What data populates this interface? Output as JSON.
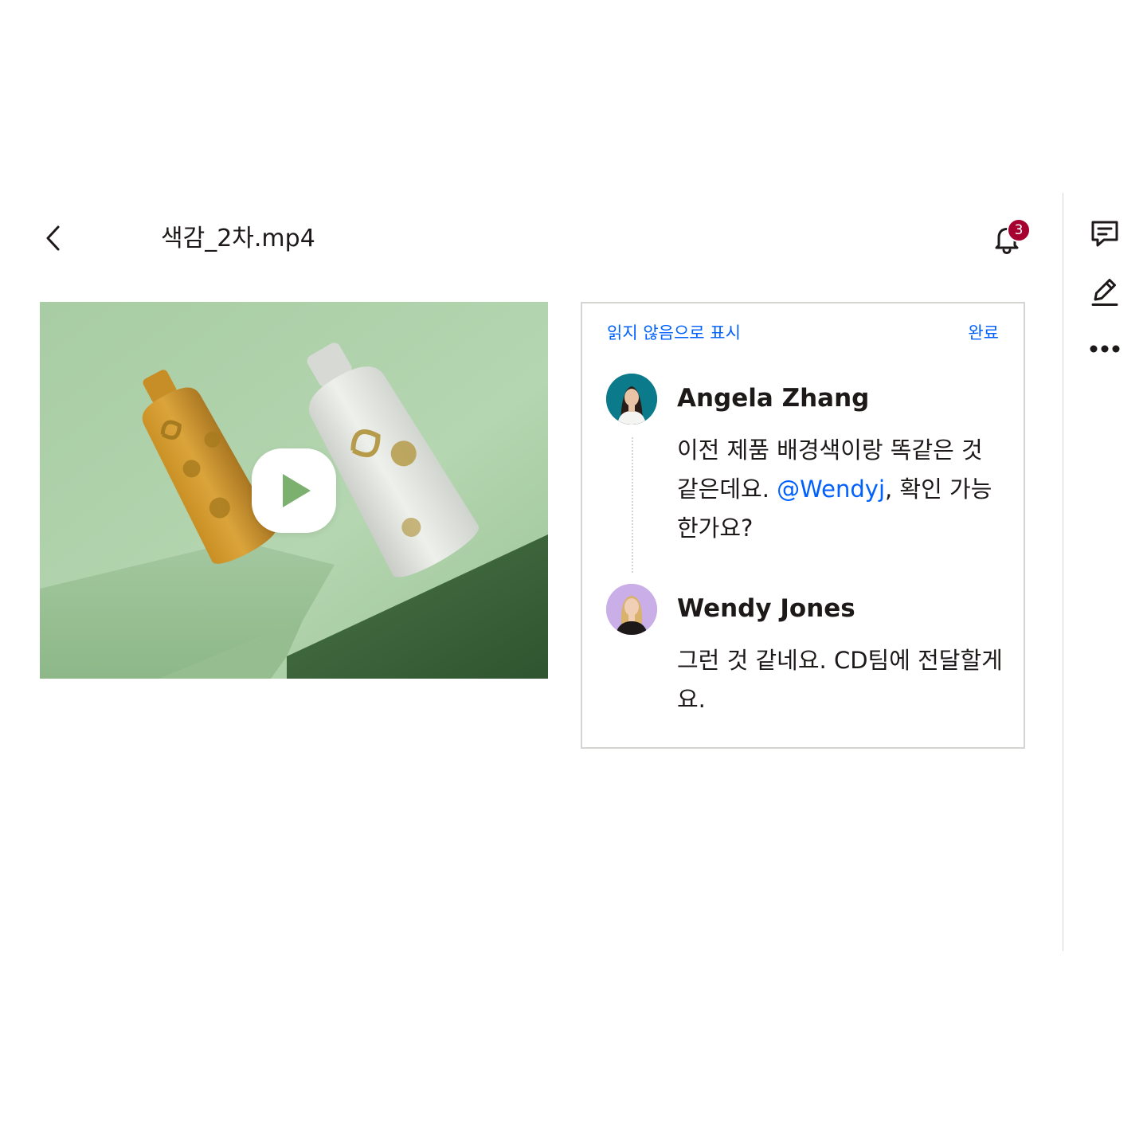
{
  "header": {
    "file_name": "색감_2차.mp4",
    "back_icon": "chevron-left-icon",
    "notifications": {
      "icon": "bell-icon",
      "count": "3",
      "badge_color": "#a5002f"
    }
  },
  "right_rail": {
    "items": [
      {
        "name": "comment",
        "icon": "comment-icon"
      },
      {
        "name": "edit",
        "icon": "pencil-icon"
      },
      {
        "name": "more",
        "icon": "more-dots-icon"
      }
    ]
  },
  "video": {
    "play_icon": "play-icon",
    "background_color": "#a9cba5"
  },
  "comment_panel": {
    "mark_unread": "읽지 않음으로 표시",
    "resolve": "완료",
    "link_color": "#0061fe",
    "comments": [
      {
        "author": "Angela Zhang",
        "body_before": "이전 제품 배경색이랑 똑같은 것 같은데요. ",
        "mention": "@Wendyj",
        "body_after": ", 확인 가능한가요?",
        "avatar_color": "#0b7a8a"
      },
      {
        "author": "Wendy Jones",
        "body": "그런 것 같네요. CD팀에 전달할게요.",
        "avatar_color": "#c9aee8"
      }
    ]
  }
}
